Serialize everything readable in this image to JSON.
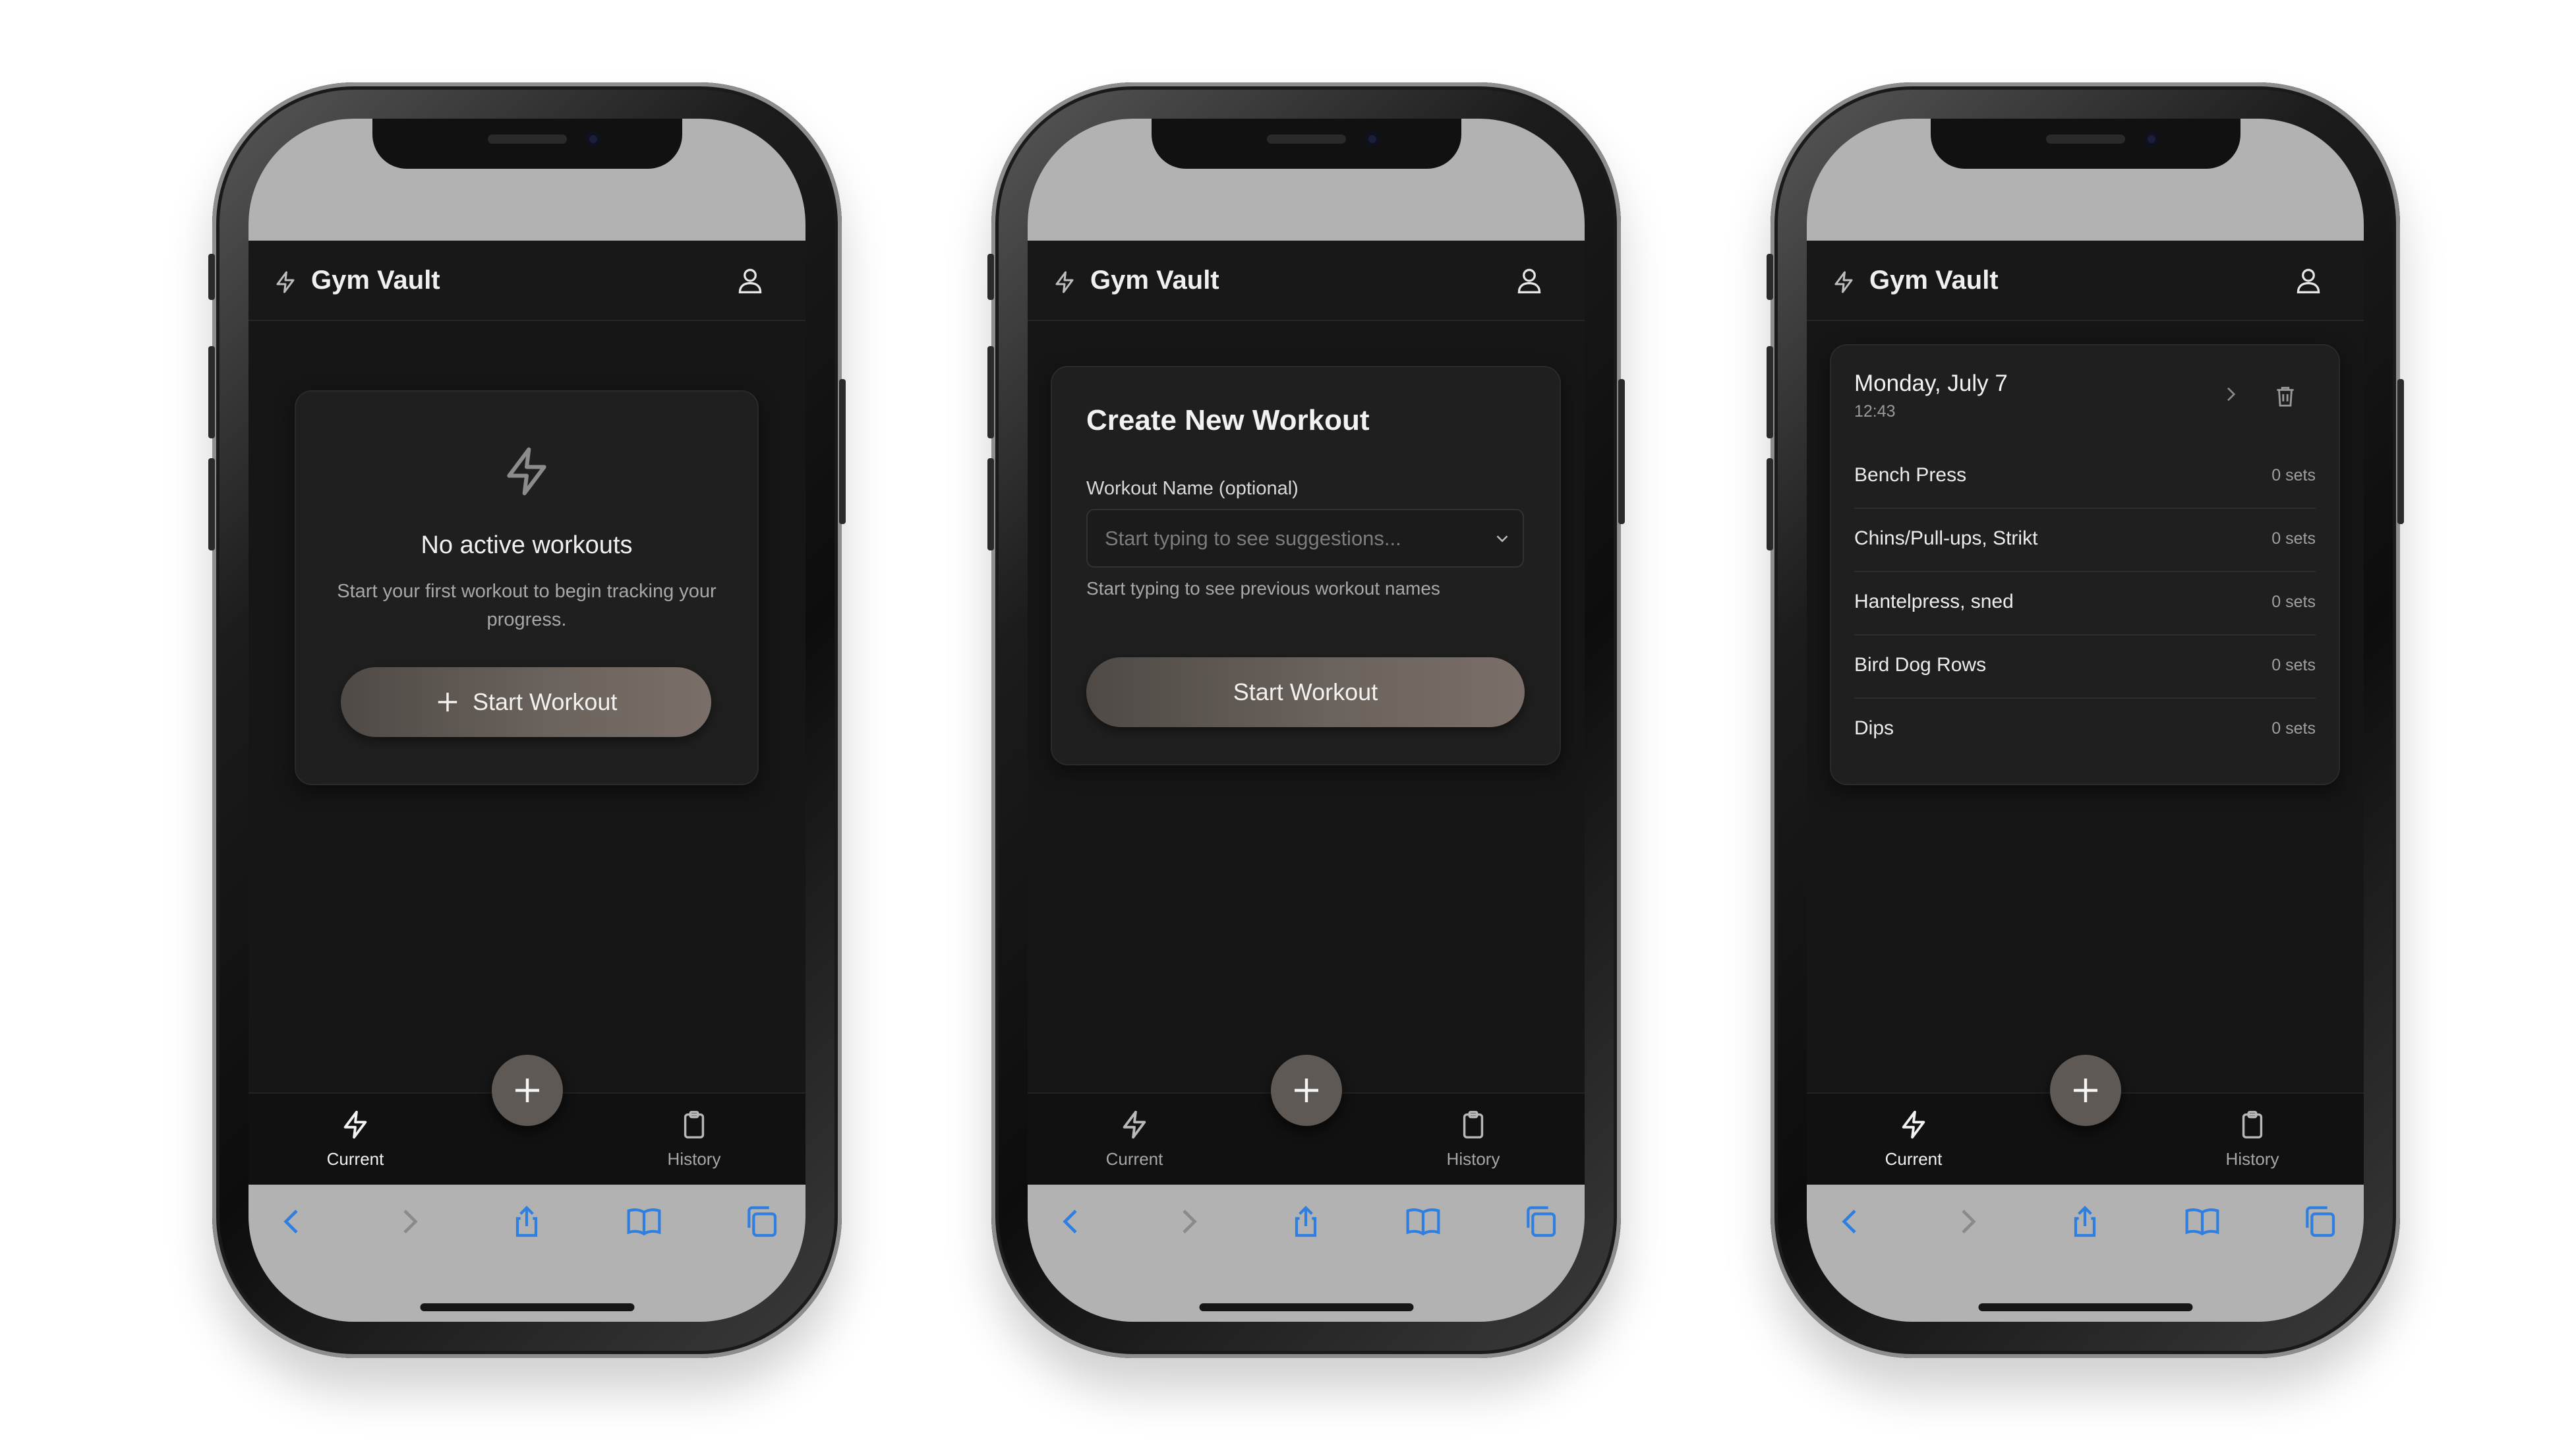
{
  "app": {
    "title": "Gym Vault"
  },
  "tabs": {
    "current": "Current",
    "history": "History"
  },
  "screen1": {
    "empty_title": "No active workouts",
    "empty_desc": "Start your first workout to begin tracking your progress.",
    "start_button": "Start Workout"
  },
  "screen2": {
    "card_title": "Create New Workout",
    "field_label": "Workout Name (optional)",
    "field_placeholder": "Start typing to see suggestions...",
    "field_hint": "Start typing to see previous workout names",
    "start_button": "Start Workout"
  },
  "screen3": {
    "date": "Monday, July 7",
    "time": "12:43",
    "exercises": [
      {
        "name": "Bench Press",
        "sets": "0 sets"
      },
      {
        "name": "Chins/Pull-ups, Strikt",
        "sets": "0 sets"
      },
      {
        "name": "Hantelpress, sned",
        "sets": "0 sets"
      },
      {
        "name": "Bird Dog Rows",
        "sets": "0 sets"
      },
      {
        "name": "Dips",
        "sets": "0 sets"
      }
    ]
  },
  "colors": {
    "background": "#161616",
    "card": "#1f1f1f",
    "accent": "#6a625c",
    "safari_blue": "#2f7fe0"
  },
  "icons": {
    "brand": "lightning-bolt-icon",
    "user": "user-icon",
    "current_tab": "lightning-bolt-icon",
    "history_tab": "clipboard-icon",
    "fab": "plus-icon"
  }
}
